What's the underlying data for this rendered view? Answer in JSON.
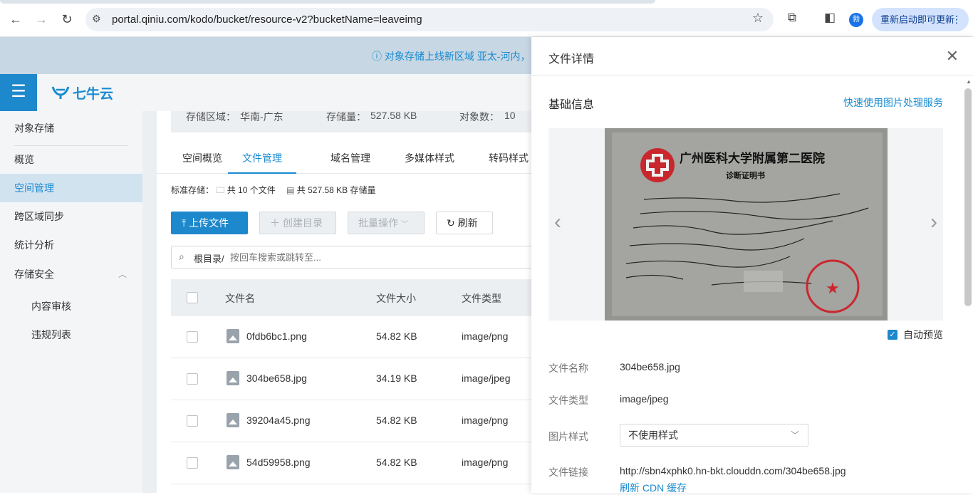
{
  "browser": {
    "url": "portal.qiniu.com/kodo/bucket/resource-v2?bucketName=leaveimg",
    "update_label": "重新启动即可更新",
    "profile_initial": "勃"
  },
  "notice": {
    "text": "ⓘ  对象存储上线新区域 亚太-河内，"
  },
  "brand": {
    "name": "七牛云"
  },
  "sidebar": {
    "items": [
      {
        "label": "对象存储"
      },
      {
        "label": "概览"
      },
      {
        "label": "空间管理"
      },
      {
        "label": "跨区域同步"
      },
      {
        "label": "统计分析"
      },
      {
        "label": "存储安全"
      },
      {
        "label": "内容审核"
      },
      {
        "label": "违规列表"
      }
    ]
  },
  "stats": {
    "region_label": "存储区域：",
    "region_value": "华南-广东",
    "size_label": "存储量：",
    "size_value": "527.58 KB",
    "count_label": "对象数：",
    "count_value": "10"
  },
  "tabs": [
    {
      "label": "空间概览"
    },
    {
      "label": "文件管理"
    },
    {
      "label": "域名管理"
    },
    {
      "label": "多媒体样式"
    },
    {
      "label": "转码样式"
    }
  ],
  "storage_summary": {
    "type": "标准存储：",
    "files": "共 10 个文件",
    "size": "共 527.58 KB 存储量"
  },
  "toolbar": {
    "upload": "上传文件",
    "mkdir": "创建目录",
    "batch": "批量操作",
    "refresh": "刷新"
  },
  "search": {
    "root": "根目录/",
    "placeholder": "按回车搜索或跳转至..."
  },
  "table": {
    "headers": {
      "name": "文件名",
      "size": "文件大小",
      "type": "文件类型"
    },
    "rows": [
      {
        "name": "0fdb6bc1.png",
        "size": "54.82 KB",
        "type": "image/png"
      },
      {
        "name": "304be658.jpg",
        "size": "34.19 KB",
        "type": "image/jpeg"
      },
      {
        "name": "39204a45.png",
        "size": "54.82 KB",
        "type": "image/png"
      },
      {
        "name": "54d59958.png",
        "size": "54.82 KB",
        "type": "image/png"
      }
    ]
  },
  "drawer": {
    "title": "文件详情",
    "section": "基础信息",
    "quick_link": "快速使用图片处理服务",
    "auto_preview": "自动预览",
    "photo_header": "广州医科大学附属第二医院",
    "photo_subheader": "诊断证明书",
    "fields": {
      "name_label": "文件名称",
      "name_value": "304be658.jpg",
      "type_label": "文件类型",
      "type_value": "image/jpeg",
      "style_label": "图片样式",
      "style_value": "不使用样式",
      "link_label": "文件链接",
      "link_value": "http://sbn4xphk0.hn-bkt.clouddn.com/304be658.jpg",
      "cdn_refresh": "刷新 CDN 缓存"
    }
  }
}
